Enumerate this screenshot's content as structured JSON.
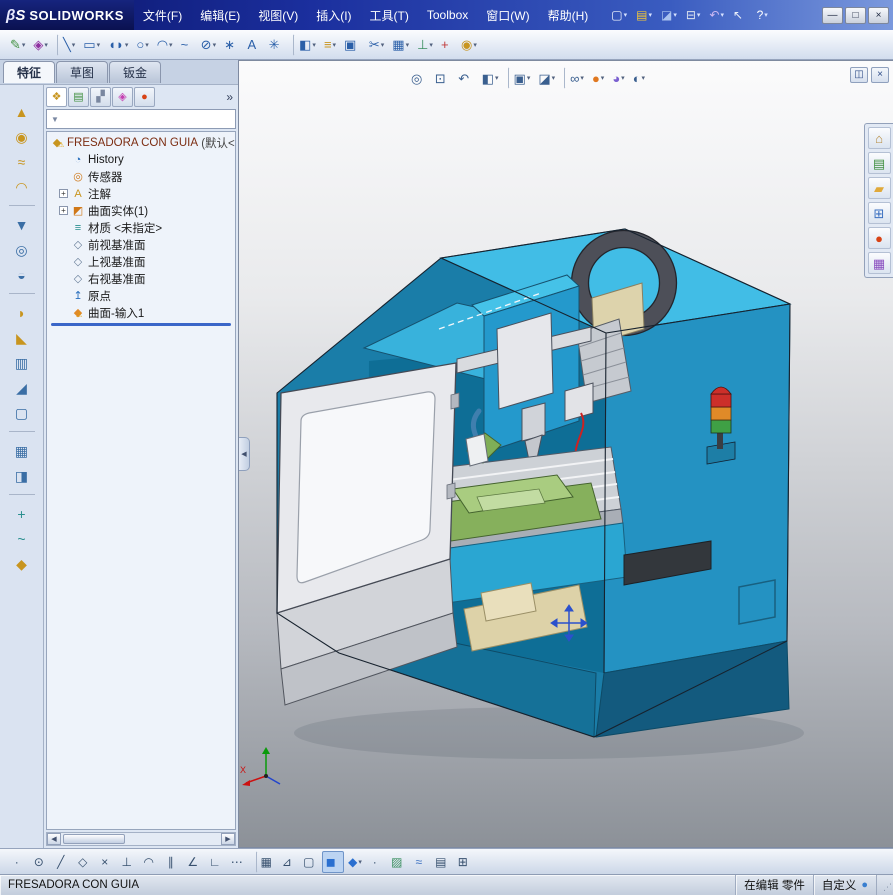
{
  "colors": {
    "titlebar_blue": "#1b2f9e",
    "machine_cyan": "#2aa5d4",
    "machine_blue_dark": "#1a6e94",
    "rollback_blue": "#3a66c8",
    "warning_yellow": "#e0a000",
    "signal_red": "#cc2f2a",
    "signal_orange": "#e08a28",
    "signal_green": "#3fa045"
  },
  "titlebar": {
    "logo_mark": "βS",
    "logo_text": "SOLIDWORKS",
    "menus": [
      {
        "name": "menu-file",
        "label": "文件(F)"
      },
      {
        "name": "menu-edit",
        "label": "编辑(E)"
      },
      {
        "name": "menu-view",
        "label": "视图(V)"
      },
      {
        "name": "menu-insert",
        "label": "插入(I)"
      },
      {
        "name": "menu-tools",
        "label": "工具(T)"
      },
      {
        "name": "menu-toolbox",
        "label": "Toolbox"
      },
      {
        "name": "menu-window",
        "label": "窗口(W)"
      },
      {
        "name": "menu-help",
        "label": "帮助(H)"
      }
    ],
    "quick_tools": [
      {
        "name": "new-document-icon",
        "glyph": "▢",
        "color": "#f5f8ff",
        "dropdown": true
      },
      {
        "name": "open-document-icon",
        "glyph": "▤",
        "color": "#f0c53a",
        "dropdown": true
      },
      {
        "name": "save-icon",
        "glyph": "◪",
        "color": "#a9c2ef",
        "dropdown": true
      },
      {
        "name": "print-icon",
        "glyph": "⊟",
        "color": "#dde3ee",
        "dropdown": true
      },
      {
        "name": "undo-icon",
        "glyph": "↶",
        "color": "#cdb9f2",
        "dropdown": true
      },
      {
        "name": "select-arrow-icon",
        "glyph": "↖",
        "color": "#eef2fa",
        "dropdown": false
      },
      {
        "name": "help-icon",
        "glyph": "?",
        "color": "#ffffff",
        "dropdown": true
      }
    ],
    "window_controls": [
      {
        "name": "minimize-button",
        "glyph": "—"
      },
      {
        "name": "maximize-button",
        "glyph": "□"
      },
      {
        "name": "close-button",
        "glyph": "×"
      }
    ]
  },
  "sketch_toolbar": [
    {
      "name": "sketch-icon",
      "glyph": "✎",
      "color": "#3f8f3f",
      "dropdown": true
    },
    {
      "name": "smart-dimension-icon",
      "glyph": "◈",
      "color": "#8f2fa0",
      "dropdown": true
    },
    {
      "name": "line-icon",
      "glyph": "╲",
      "dropdown": true,
      "sep": true
    },
    {
      "name": "rectangle-icon",
      "glyph": "▭",
      "dropdown": true
    },
    {
      "name": "straight-slot-icon",
      "glyph": "◖◗",
      "dropdown": true
    },
    {
      "name": "circle-icon",
      "glyph": "○",
      "dropdown": true
    },
    {
      "name": "centerpoint-arc-icon",
      "glyph": "◠",
      "dropdown": true
    },
    {
      "name": "spline-icon",
      "glyph": "~",
      "dropdown": false
    },
    {
      "name": "ellipse-icon",
      "glyph": "⊘",
      "dropdown": true
    },
    {
      "name": "point-icon",
      "glyph": "∗",
      "dropdown": false
    },
    {
      "name": "text-icon",
      "glyph": "A",
      "dropdown": false
    },
    {
      "name": "make-path-icon",
      "glyph": "✳",
      "dropdown": false
    },
    {
      "name": "mirror-entities-icon",
      "glyph": "◧",
      "dropdown": true,
      "sep": true
    },
    {
      "name": "offset-entities-icon",
      "glyph": "≡",
      "color": "#c8951f",
      "dropdown": true
    },
    {
      "name": "convert-entities-icon",
      "glyph": "▣",
      "dropdown": false
    },
    {
      "name": "trim-entities-icon",
      "glyph": "✂",
      "dropdown": true
    },
    {
      "name": "linear-sketch-pattern-icon",
      "glyph": "▦",
      "dropdown": true
    },
    {
      "name": "display-relations-icon",
      "glyph": "⊥",
      "color": "#3a8f5f",
      "dropdown": true
    },
    {
      "name": "repair-sketch-icon",
      "glyph": "+",
      "color": "#c03a3a",
      "dropdown": false
    },
    {
      "name": "rapid-sketch-icon",
      "glyph": "◉",
      "color": "#c8951f",
      "dropdown": true
    }
  ],
  "command_tabs": [
    {
      "name": "tab-features",
      "label": "特征",
      "active": true
    },
    {
      "name": "tab-sketch",
      "label": "草图"
    },
    {
      "name": "tab-sheet-metal",
      "label": "钣金"
    }
  ],
  "features_strip": [
    {
      "name": "extruded-boss-icon",
      "glyph": "▲",
      "color": "#c8951f"
    },
    {
      "name": "revolved-boss-icon",
      "glyph": "◉",
      "color": "#c8951f"
    },
    {
      "name": "swept-boss-icon",
      "glyph": "≈",
      "color": "#c8951f"
    },
    {
      "name": "lofted-boss-icon",
      "glyph": "◠",
      "color": "#c8951f"
    },
    {
      "divider": true
    },
    {
      "name": "extruded-cut-icon",
      "glyph": "▼",
      "color": "#3a6ea5"
    },
    {
      "name": "hole-wizard-icon",
      "glyph": "◎",
      "color": "#3a6ea5"
    },
    {
      "name": "revolved-cut-icon",
      "glyph": "◒",
      "color": "#3a6ea5"
    },
    {
      "divider": true
    },
    {
      "name": "fillet-icon",
      "glyph": "◗",
      "color": "#c8951f"
    },
    {
      "name": "chamfer-icon",
      "glyph": "◣",
      "color": "#c8951f"
    },
    {
      "name": "rib-icon",
      "glyph": "▥",
      "color": "#3a6ea5"
    },
    {
      "name": "draft-icon",
      "glyph": "◢",
      "color": "#3a6ea5"
    },
    {
      "name": "shell-icon",
      "glyph": "▢",
      "color": "#3a6ea5"
    },
    {
      "divider": true
    },
    {
      "name": "linear-pattern-icon",
      "glyph": "▦",
      "color": "#3a6ea5"
    },
    {
      "name": "mirror-icon",
      "glyph": "◨",
      "color": "#3a6ea5"
    },
    {
      "divider": true
    },
    {
      "name": "reference-geometry-icon",
      "glyph": "+",
      "color": "#2a8f8f"
    },
    {
      "name": "curves-icon",
      "glyph": "~",
      "color": "#2a8f8f"
    },
    {
      "name": "instant3d-icon",
      "glyph": "◆",
      "color": "#c8951f"
    }
  ],
  "feature_manager": {
    "header_icons": [
      {
        "name": "featuremanager-tree-tab-icon",
        "glyph": "❖",
        "color": "#c8951f",
        "active": true
      },
      {
        "name": "propertymanager-tab-icon",
        "glyph": "▤",
        "color": "#3f8f3f"
      },
      {
        "name": "configuration-manager-tab-icon",
        "glyph": "▞",
        "color": "#7a87a0"
      },
      {
        "name": "dimxpert-tab-icon",
        "glyph": "◈",
        "color": "#c43fb0"
      },
      {
        "name": "displaymanager-tab-icon",
        "glyph": "●",
        "color": "#d84315"
      }
    ],
    "overflow_glyph": "»",
    "filter_glyph": "▼",
    "filter_placeholder": "",
    "tree": {
      "root": {
        "glyph": "◆",
        "color": "#c8951f",
        "label": "FRESADORA CON GUIA",
        "suffix": "(默认<",
        "label_color": "#7c2d12",
        "warn": true
      },
      "items": [
        {
          "glyph": "◔",
          "color": "#2a6fbd",
          "label": "History"
        },
        {
          "glyph": "◎",
          "color": "#d07818",
          "label": "传感器"
        },
        {
          "expand": true,
          "glyph": "A",
          "color": "#c8951f",
          "label": "注解"
        },
        {
          "expand": true,
          "glyph": "◩",
          "color": "#d07818",
          "label": "曲面实体(1)"
        },
        {
          "glyph": "≡",
          "color": "#2a8f8f",
          "label": "材质 <未指定>"
        },
        {
          "glyph": "◇",
          "color": "#6a7f9a",
          "label": "前视基准面"
        },
        {
          "glyph": "◇",
          "color": "#6a7f9a",
          "label": "上视基准面"
        },
        {
          "glyph": "◇",
          "color": "#6a7f9a",
          "label": "右视基准面"
        },
        {
          "glyph": "↥",
          "color": "#2a6fbd",
          "label": "原点"
        },
        {
          "glyph": "◆",
          "color": "#e08a28",
          "label": "曲面-输入1",
          "warn": true
        }
      ]
    }
  },
  "viewport": {
    "heads_up": [
      {
        "name": "zoom-to-fit-icon",
        "glyph": "◎",
        "color": "#3a5f8f"
      },
      {
        "name": "zoom-to-area-icon",
        "glyph": "⊡",
        "color": "#3a5f8f"
      },
      {
        "name": "previous-view-icon",
        "glyph": "↶",
        "color": "#3a5f8f"
      },
      {
        "name": "section-view-icon",
        "glyph": "◧",
        "color": "#3a5f8f",
        "dropdown": true
      },
      {
        "name": "view-orientation-icon",
        "glyph": "▣",
        "color": "#3a5f8f",
        "dropdown": true,
        "sep": true
      },
      {
        "name": "display-style-icon",
        "glyph": "◪",
        "color": "#3a5f8f",
        "dropdown": true
      },
      {
        "name": "hide-show-items-icon",
        "glyph": "∞",
        "color": "#3a5f8f",
        "dropdown": true,
        "sep": true
      },
      {
        "name": "edit-appearance-icon",
        "glyph": "●",
        "color": "#e07820",
        "dropdown": true
      },
      {
        "name": "apply-scene-icon",
        "glyph": "◕",
        "color": "#7a5fd0",
        "dropdown": true
      },
      {
        "name": "view-settings-icon",
        "glyph": "◐",
        "color": "#3a5f8f",
        "dropdown": true
      }
    ],
    "pane_buttons": [
      {
        "name": "split-pane-icon",
        "glyph": "◫"
      },
      {
        "name": "close-pane-icon",
        "glyph": "×"
      }
    ],
    "task_pane": [
      {
        "name": "solidworks-resources-icon",
        "glyph": "⌂",
        "color": "#b5893a"
      },
      {
        "name": "design-library-icon",
        "glyph": "▤",
        "color": "#3f8f3f"
      },
      {
        "name": "file-explorer-icon",
        "glyph": "▰",
        "color": "#e0a93a"
      },
      {
        "name": "view-palette-icon",
        "glyph": "⊞",
        "color": "#3a6fc0"
      },
      {
        "name": "appearances-icon",
        "glyph": "●",
        "color": "#d84315"
      },
      {
        "name": "custom-properties-icon",
        "glyph": "▦",
        "color": "#8a4fc0"
      }
    ],
    "triad_x_label": "X"
  },
  "snap_toolbar": [
    {
      "name": "snap-points-icon",
      "glyph": "·"
    },
    {
      "name": "snap-center-icon",
      "glyph": "⊙"
    },
    {
      "name": "snap-line-icon",
      "glyph": "╱"
    },
    {
      "name": "snap-midpoint-icon",
      "glyph": "◇"
    },
    {
      "name": "snap-intersection-icon",
      "glyph": "×"
    },
    {
      "name": "snap-perpendicular-icon",
      "glyph": "⊥"
    },
    {
      "name": "snap-tangent-icon",
      "glyph": "◠"
    },
    {
      "name": "snap-parallel-icon",
      "glyph": "∥"
    },
    {
      "name": "snap-angle-icon",
      "glyph": "∠"
    },
    {
      "name": "snap-length-icon",
      "glyph": "∟"
    },
    {
      "name": "snap-grid-icon",
      "glyph": "⋯"
    },
    {
      "name": "grid-settings-icon",
      "glyph": "▦",
      "sep": true
    },
    {
      "name": "unit-system-icon",
      "glyph": "⊿"
    },
    {
      "name": "dimension-standard-icon",
      "glyph": "▢"
    },
    {
      "name": "shaded-with-edges-icon",
      "glyph": "◼",
      "color": "#2a6fd0",
      "active": true
    },
    {
      "name": "view-cube-icon",
      "glyph": "◆",
      "color": "#2a6fd0",
      "dropdown": true
    },
    {
      "name": "point-style-icon",
      "glyph": "·"
    },
    {
      "name": "texture-display-icon",
      "glyph": "▨",
      "color": "#3a8f5f"
    },
    {
      "name": "realview-icon",
      "glyph": "≈",
      "color": "#3a6fc0"
    },
    {
      "name": "scene-panel-icon",
      "glyph": "▤"
    },
    {
      "name": "grid-table-icon",
      "glyph": "⊞"
    }
  ],
  "statusbar": {
    "message": "FRESADORA CON GUIA",
    "mode": "在编辑 零件",
    "custom": "自定义"
  }
}
